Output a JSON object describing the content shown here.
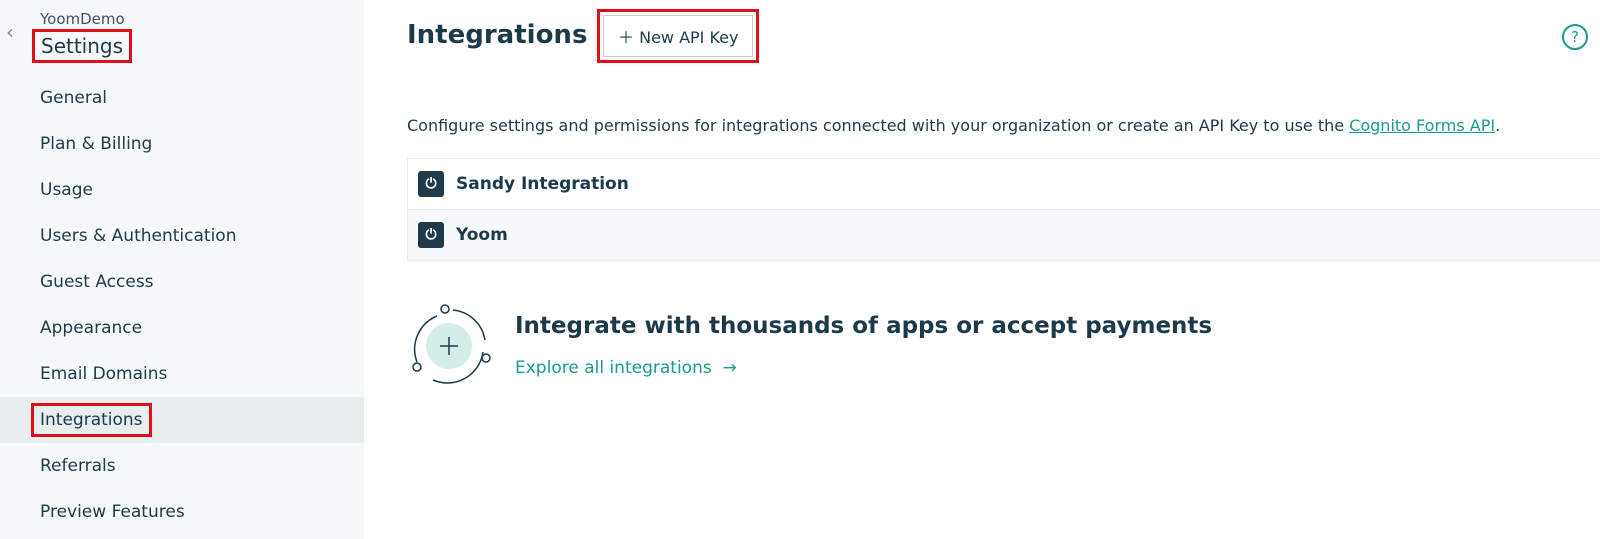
{
  "sidebar": {
    "org": "YoomDemo",
    "title": "Settings",
    "items": [
      {
        "label": "General"
      },
      {
        "label": "Plan & Billing"
      },
      {
        "label": "Usage"
      },
      {
        "label": "Users & Authentication"
      },
      {
        "label": "Guest Access"
      },
      {
        "label": "Appearance"
      },
      {
        "label": "Email Domains"
      },
      {
        "label": "Integrations"
      },
      {
        "label": "Referrals"
      },
      {
        "label": "Preview Features"
      }
    ]
  },
  "main": {
    "title": "Integrations",
    "new_key_label": "New API Key",
    "description": "Configure settings and permissions for integrations connected with your organization or create an API Key to use the ",
    "link": "Cognito Forms API",
    "period": ".",
    "integrations": [
      {
        "name": "Sandy Integration"
      },
      {
        "name": "Yoom"
      }
    ],
    "promo_title": "Integrate with thousands of apps or accept payments",
    "explore": "Explore all integrations"
  }
}
